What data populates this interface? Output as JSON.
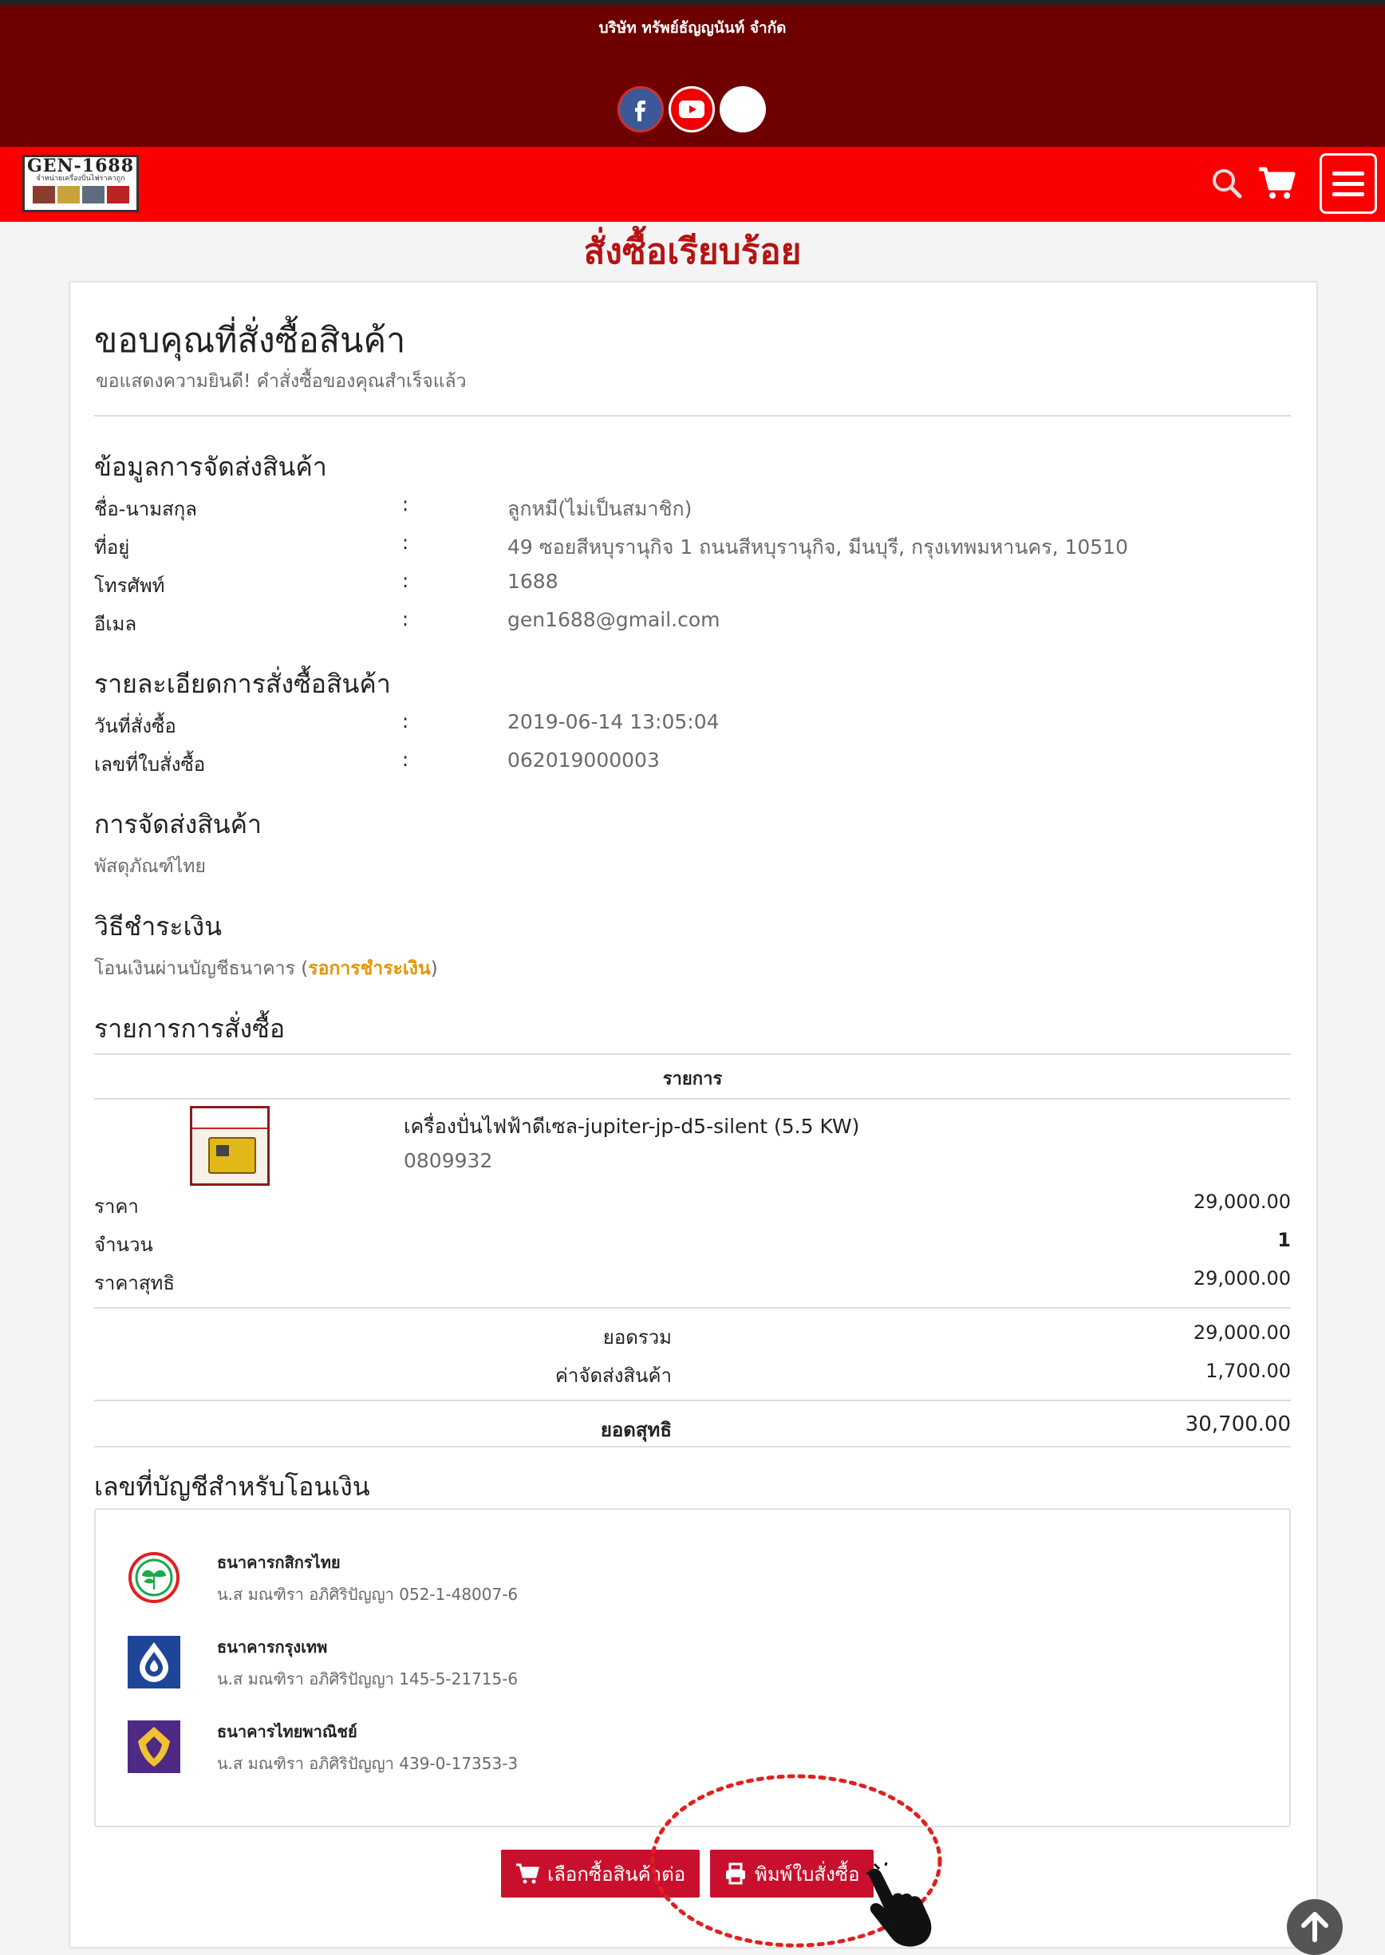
{
  "header": {
    "company_name": "บริษัท ทรัพย์ธัญญนันท์ จำกัด",
    "social": [
      "facebook-icon",
      "youtube-icon",
      "line-icon"
    ],
    "logo_text": "GEN-1688",
    "logo_sub": "จำหน่ายเครื่องปั่นไฟราคาถูก"
  },
  "page_title": "สั่งซื้อเรียบร้อย",
  "thanks": {
    "heading": "ขอบคุณที่สั่งซื้อสินค้า",
    "message": "ขอแสดงความยินดี! คำสั่งซื้อของคุณสำเร็จแล้ว"
  },
  "shipping_info": {
    "heading": "ข้อมูลการจัดส่งสินค้า",
    "rows": [
      {
        "label": "ชื่อ-นามสกุล",
        "sep": ":",
        "value": "ลูกหมี(ไม่เป็นสมาชิก)"
      },
      {
        "label": "ที่อยู่",
        "sep": ":",
        "value": "49 ซอยสีหบุรานุกิจ 1 ถนนสีหบุรานุกิจ, มีนบุรี, กรุงเทพมหานคร, 10510"
      },
      {
        "label": "โทรศัพท์",
        "sep": ":",
        "value": "1688"
      },
      {
        "label": "อีเมล",
        "sep": ":",
        "value": "gen1688@gmail.com"
      }
    ]
  },
  "order_details": {
    "heading": "รายละเอียดการสั่งซื้อสินค้า",
    "rows": [
      {
        "label": "วันที่สั่งซื้อ",
        "sep": ":",
        "value": "2019-06-14 13:05:04"
      },
      {
        "label": "เลขที่ใบสั่งซื้อ",
        "sep": ":",
        "value": "062019000003"
      }
    ]
  },
  "delivery": {
    "heading": "การจัดส่งสินค้า",
    "method": "พัสดุภัณฑ์ไทย"
  },
  "payment": {
    "heading": "วิธีชำระเงิน",
    "method": "โอนเงินผ่านบัญชีธนาคาร",
    "paren_open": "(",
    "status": "รอการชำระเงิน",
    "paren_close": ")"
  },
  "order_items": {
    "heading": "รายการการสั่งซื้อ",
    "column_header": "รายการ",
    "item": {
      "name": "เครื่องปั่นไฟฟ้าดีเซล-jupiter-jp-d5-silent (5.5 KW)",
      "code": "0809932",
      "price_label": "ราคา",
      "price": "29,000.00",
      "qty_label": "จำนวน",
      "qty": "1",
      "net_label": "ราคาสุทธิ",
      "net": "29,000.00"
    }
  },
  "totals": {
    "subtotal_label": "ยอดรวม",
    "subtotal": "29,000.00",
    "shipping_label": "ค่าจัดส่งสินค้า",
    "shipping": "1,700.00",
    "grand_label": "ยอดสุทธิ",
    "grand": "30,700.00"
  },
  "bank_accounts": {
    "heading": "เลขที่บัญชีสำหรับโอนเงิน",
    "banks": [
      {
        "name": "ธนาคารกสิกรไทย",
        "account": "น.ส มณฑิรา อภิศิริปัญญา 052-1-48007-6",
        "icon": "kasikorn-bank-icon",
        "color": "#1ba84a"
      },
      {
        "name": "ธนาคารกรุงเทพ",
        "account": "น.ส มณฑิรา อภิศิริปัญญา 145-5-21715-6",
        "icon": "bangkok-bank-icon",
        "color": "#1e4598"
      },
      {
        "name": "ธนาคารไทยพาณิชย์",
        "account": "น.ส มณฑิรา อภิศิริปัญญา 439-0-17353-3",
        "icon": "scb-bank-icon",
        "color": "#4e2a84"
      }
    ]
  },
  "actions": {
    "continue_label": "เลือกซื้อสินค้าต่อ",
    "print_label": "พิมพ์ใบสั่งซื้อ"
  },
  "colors": {
    "topbar": "#6e0000",
    "navbar": "#fb0000",
    "title": "#b51414",
    "button": "#c8102e",
    "status": "#e69500"
  }
}
